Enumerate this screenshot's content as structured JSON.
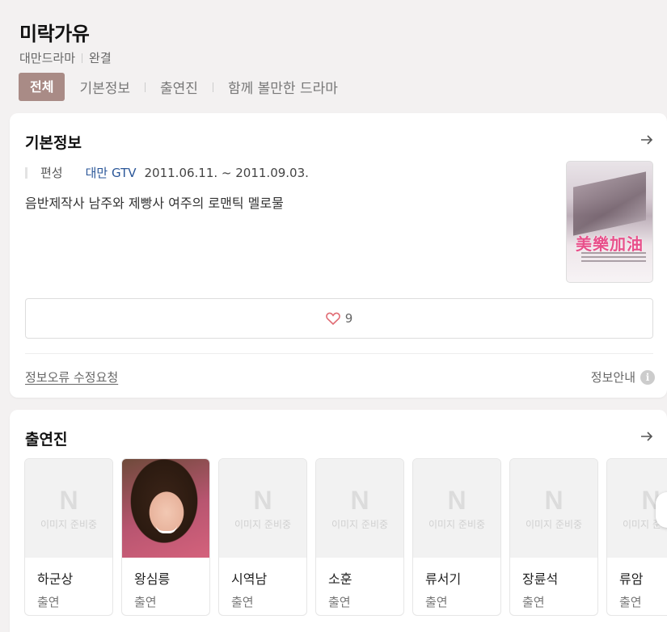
{
  "header": {
    "title": "미락가유",
    "genre": "대만드라마",
    "status": "완결",
    "tabs": [
      "전체",
      "기본정보",
      "출연진",
      "함께 볼만한 드라마"
    ]
  },
  "basic_info": {
    "section_title": "기본정보",
    "label": "편성",
    "channel": "대만 GTV",
    "period": "2011.06.11. ~ 2011.09.03.",
    "description": "음반제작사 남주와 제빵사 여주의 로맨틱 멜로물",
    "poster_text": "美樂加油",
    "likes": "9",
    "report_link": "정보오류 수정요청",
    "info_guide": "정보안내"
  },
  "cast": {
    "section_title": "출연진",
    "placeholder_letter": "N",
    "placeholder_text": "이미지 준비중",
    "members": [
      {
        "name": "하군상",
        "role": "출연",
        "has_photo": false
      },
      {
        "name": "왕심릉",
        "role": "출연",
        "has_photo": true
      },
      {
        "name": "시역남",
        "role": "출연",
        "has_photo": false
      },
      {
        "name": "소훈",
        "role": "출연",
        "has_photo": false
      },
      {
        "name": "류서기",
        "role": "출연",
        "has_photo": false
      },
      {
        "name": "장륜석",
        "role": "출연",
        "has_photo": false
      },
      {
        "name": "류암",
        "role": "출연",
        "has_photo": false
      }
    ]
  },
  "colors": {
    "accent": "#a98b86",
    "link": "#2a5698",
    "heart": "#e06b73"
  }
}
